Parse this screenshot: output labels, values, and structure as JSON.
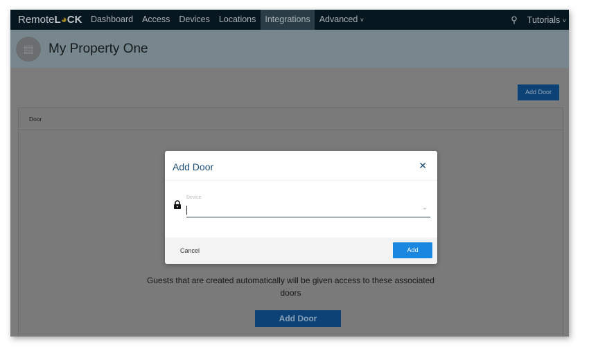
{
  "nav": {
    "logo_a": "Remote",
    "logo_b": "L",
    "logo_c": "CK",
    "items": [
      "Dashboard",
      "Access",
      "Devices",
      "Locations",
      "Integrations",
      "Advanced"
    ],
    "active": "Integrations",
    "tutorials": "Tutorials"
  },
  "header": {
    "title": "My Property One"
  },
  "page": {
    "add_door_top": "Add Door",
    "column_door": "Door",
    "message": "Guests that are created automatically will be given access to these associated doors",
    "add_door_bottom": "Add Door"
  },
  "modal": {
    "title": "Add Door",
    "device_label": "Device",
    "device_value": "",
    "cancel": "Cancel",
    "add": "Add"
  },
  "colors": {
    "primary": "#1a87e0",
    "title": "#1f4e79",
    "navbar": "#07171f"
  }
}
